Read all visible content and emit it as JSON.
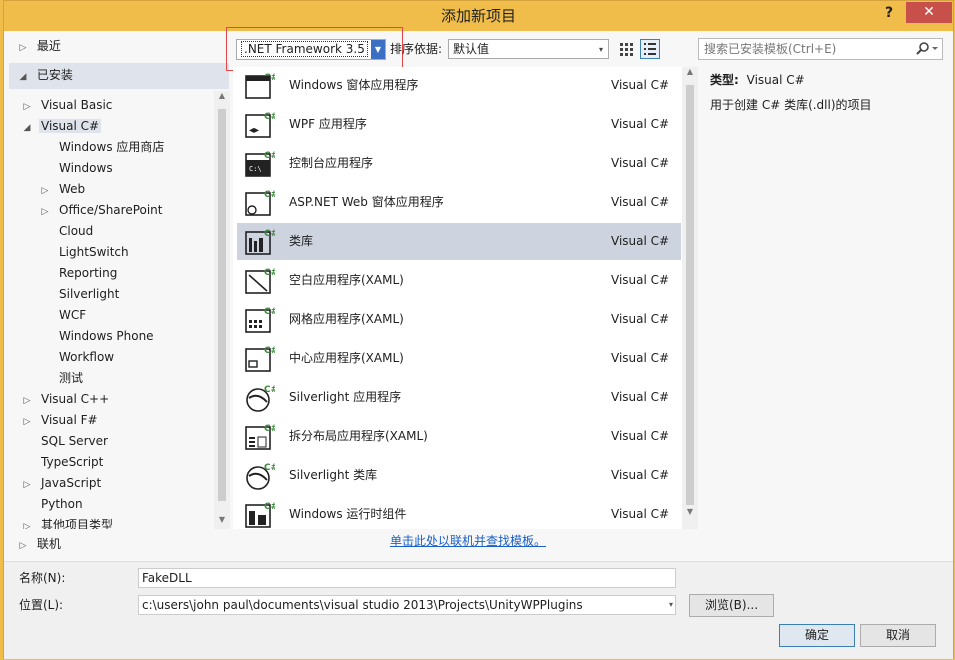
{
  "window": {
    "title": "添加新项目"
  },
  "titlebar": {
    "help": "?",
    "close": "✕"
  },
  "tree": {
    "recent": "最近",
    "installed": "已安装",
    "items": [
      {
        "label": "Visual Basic",
        "level": 0,
        "arrow": "▷"
      },
      {
        "label": "Visual C#",
        "level": 0,
        "arrow": "◢",
        "selected": true
      },
      {
        "label": "Windows 应用商店",
        "level": 1,
        "arrow": ""
      },
      {
        "label": "Windows",
        "level": 1,
        "arrow": ""
      },
      {
        "label": "Web",
        "level": 1,
        "arrow": "▷"
      },
      {
        "label": "Office/SharePoint",
        "level": 1,
        "arrow": "▷"
      },
      {
        "label": "Cloud",
        "level": 1,
        "arrow": ""
      },
      {
        "label": "LightSwitch",
        "level": 1,
        "arrow": ""
      },
      {
        "label": "Reporting",
        "level": 1,
        "arrow": ""
      },
      {
        "label": "Silverlight",
        "level": 1,
        "arrow": ""
      },
      {
        "label": "WCF",
        "level": 1,
        "arrow": ""
      },
      {
        "label": "Windows Phone",
        "level": 1,
        "arrow": ""
      },
      {
        "label": "Workflow",
        "level": 1,
        "arrow": ""
      },
      {
        "label": "测试",
        "level": 1,
        "arrow": ""
      },
      {
        "label": "Visual C++",
        "level": 0,
        "arrow": "▷"
      },
      {
        "label": "Visual F#",
        "level": 0,
        "arrow": "▷"
      },
      {
        "label": "SQL Server",
        "level": 0,
        "arrow": ""
      },
      {
        "label": "TypeScript",
        "level": 0,
        "arrow": ""
      },
      {
        "label": "JavaScript",
        "level": 0,
        "arrow": "▷"
      },
      {
        "label": "Python",
        "level": 0,
        "arrow": ""
      },
      {
        "label": "其他项目类型",
        "level": 0,
        "arrow": "▷"
      }
    ],
    "online": "联机"
  },
  "toolbar": {
    "framework": ".NET Framework 3.5",
    "sort_label": "排序依据:",
    "sort_value": "默认值",
    "search_placeholder": "搜索已安装模板(Ctrl+E)"
  },
  "templates": [
    {
      "name": "Windows 窗体应用程序",
      "lang": "Visual C#",
      "icon": "winforms-icon"
    },
    {
      "name": "WPF 应用程序",
      "lang": "Visual C#",
      "icon": "wpf-icon"
    },
    {
      "name": "控制台应用程序",
      "lang": "Visual C#",
      "icon": "console-icon"
    },
    {
      "name": "ASP.NET Web 窗体应用程序",
      "lang": "Visual C#",
      "icon": "aspnet-icon"
    },
    {
      "name": "类库",
      "lang": "Visual C#",
      "icon": "class-library-icon",
      "selected": true
    },
    {
      "name": "空白应用程序(XAML)",
      "lang": "Visual C#",
      "icon": "blank-app-icon"
    },
    {
      "name": "网格应用程序(XAML)",
      "lang": "Visual C#",
      "icon": "grid-app-icon"
    },
    {
      "name": "中心应用程序(XAML)",
      "lang": "Visual C#",
      "icon": "hub-app-icon"
    },
    {
      "name": "Silverlight 应用程序",
      "lang": "Visual C#",
      "icon": "silverlight-app-icon"
    },
    {
      "name": "拆分布局应用程序(XAML)",
      "lang": "Visual C#",
      "icon": "split-app-icon"
    },
    {
      "name": "Silverlight 类库",
      "lang": "Visual C#",
      "icon": "silverlight-lib-icon"
    },
    {
      "name": "Windows 运行时组件",
      "lang": "Visual C#",
      "icon": "winrt-component-icon"
    }
  ],
  "info": {
    "type_label": "类型:",
    "type_value": "Visual C#",
    "description": "用于创建 C# 类库(.dll)的项目"
  },
  "online_link": "单击此处以联机并查找模板。",
  "form": {
    "name_label": "名称(N):",
    "name_value": "FakeDLL",
    "location_label": "位置(L):",
    "location_value": "c:\\users\\john paul\\documents\\visual studio 2013\\Projects\\UnityWPPlugins",
    "browse": "浏览(B)...",
    "ok": "确定",
    "cancel": "取消"
  }
}
